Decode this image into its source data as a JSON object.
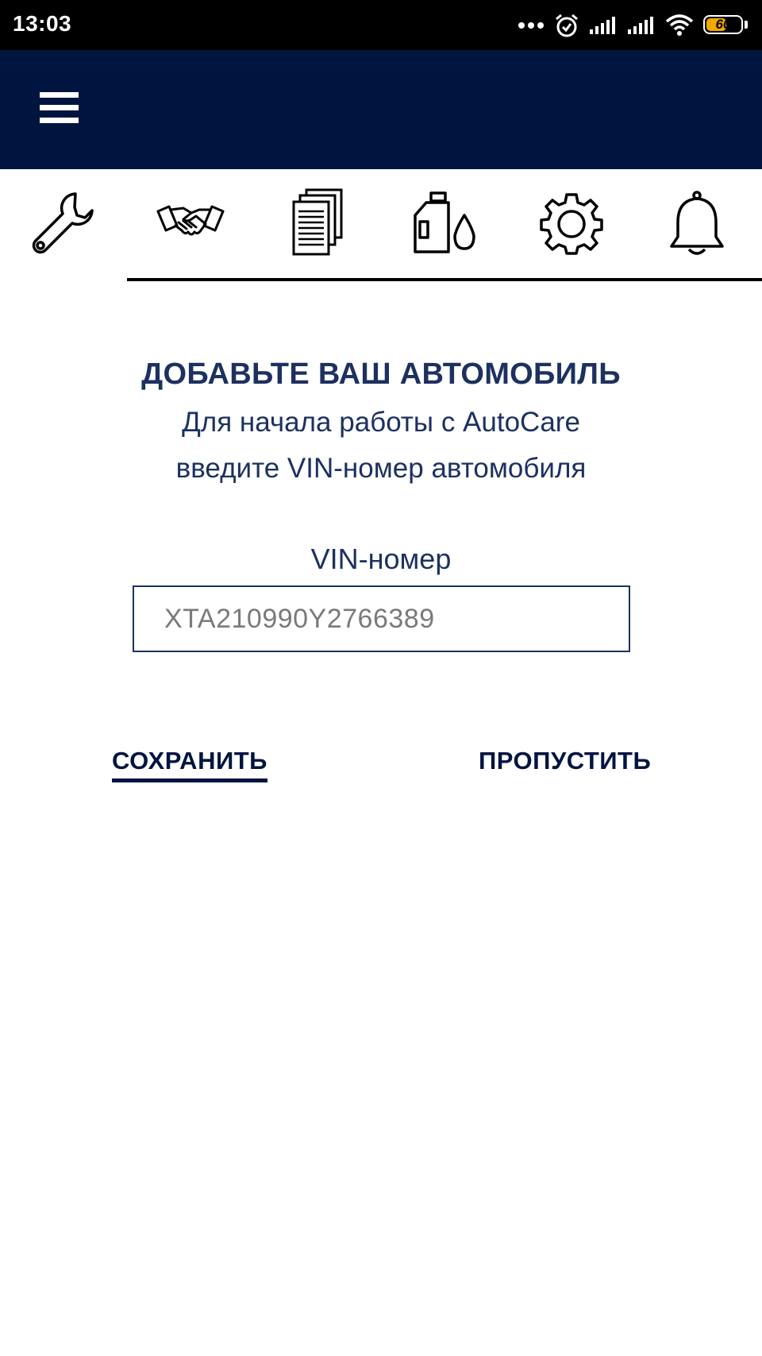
{
  "status_bar": {
    "time": "13:03",
    "battery_level": "60",
    "battery_percent": 60,
    "icons": [
      "more-dots-icon",
      "alarm-icon",
      "signal-icon",
      "signal-icon",
      "wifi-icon",
      "battery-icon"
    ]
  },
  "app_bar": {
    "menu_icon": "hamburger-menu-icon",
    "background_color": "#001440"
  },
  "tabs": [
    {
      "icon": "wrench-icon",
      "active": true
    },
    {
      "icon": "handshake-icon",
      "active": false
    },
    {
      "icon": "documents-icon",
      "active": false
    },
    {
      "icon": "oil-icon",
      "active": false
    },
    {
      "icon": "gear-icon",
      "active": false
    },
    {
      "icon": "bell-icon",
      "active": false
    }
  ],
  "content": {
    "title": "ДОБАВЬТЕ ВАШ АВТОМОБИЛЬ",
    "subtitle_line1": "Для начала работы с AutoCare",
    "subtitle_line2": "введите VIN-номер автомобиля",
    "vin_label": "VIN-номер",
    "vin_placeholder": "XTA210990Y2766389",
    "vin_value": ""
  },
  "actions": {
    "save_label": "СОХРАНИТЬ",
    "skip_label": "ПРОПУСТИТЬ"
  },
  "colors": {
    "primary_navy": "#001440",
    "text_blue": "#1d3160",
    "battery_yellow": "#f2a900"
  }
}
